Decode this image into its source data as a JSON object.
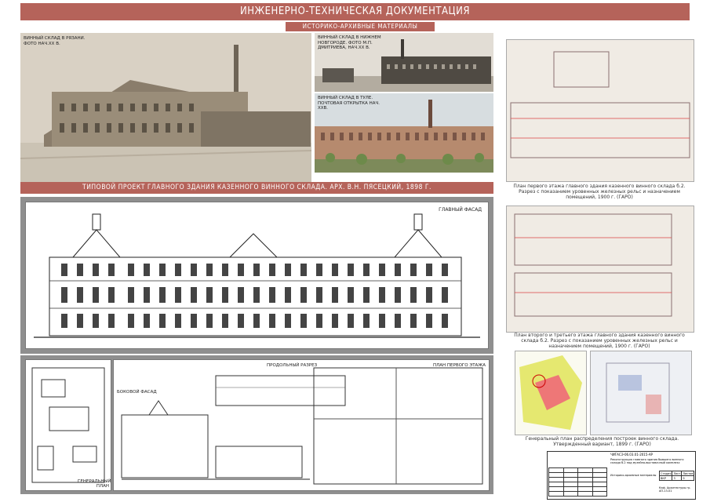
{
  "header": {
    "title": "ИНЖЕНЕРНО-ТЕХНИЧЕСКАЯ ДОКУМЕНТАЦИЯ",
    "subtitle": "ИСТОРИКО-АРХИВНЫЕ МАТЕРИАЛЫ"
  },
  "photos": {
    "ryazan": "ВИННЫЙ СКЛАД В РЯЗАНИ. ФОТО НАЧ.XX В.",
    "nn": "ВИННЫЙ СКЛАД В НИЖНЕМ НОВГОРОДЕ. ФОТО М.П. ДМИТРИЕВА, НАЧ.XX В.",
    "tula": "ВИННЫЙ СКЛАД В ТУЛЕ. ПОЧТОВАЯ ОТКРЫТКА НАЧ. XXВ."
  },
  "project_title": "ТИПОВОЙ ПРОЕКТ ГЛАВНОГО ЗДАНИЯ КАЗЕННОГО ВИННОГО СКЛАДА. АРХ. В.Н. ПЯСЕЦКИЙ, 1898 Г.",
  "drawings": {
    "main_facade": "ГЛАВНЫЙ ФАСАД",
    "section": "ПРОДОЛЬНЫЙ РАЗРЕЗ",
    "first_floor": "ПЛАН ПЕРВОГО ЭТАЖА",
    "side_facade": "БОКОВОЙ ФАСАД",
    "general_plan": "ГЕНЕРАЛЬНЫЙ ПЛАН"
  },
  "archive_captions": {
    "plan1": "План первого этажа главного здания казенного винного склада б.2. Разрез с показанием уровенных железных рельс и назначением помещений, 1900 г. (ГАРО)",
    "plan2": "План второго и третьего этажа главного здания казенного винного склада б.2. Разрез с показанием уровенных железных рельс и назначением помещений, 1900 г. (ГАРО)",
    "genplan": "Генеральный план распределения построек винного склада. Утвержденный вариант, 1899 г. (ГАРО)"
  },
  "stamp": {
    "code": "ЧИГАСЭ-06.03.01-2015-АР",
    "desc": "Реконструкция главного здания бывшего винного склада б.2 под музейно-выставочный комплекс",
    "sheet_title": "Историко-архивные материалы",
    "org": "Каф. Архитектуры гр. АП-13-01",
    "stage_label": "Стадия",
    "sheet_label": "Лист",
    "sheets_label": "Листов",
    "stage": "ВКР",
    "sheet": "3",
    "sheets": "9"
  }
}
